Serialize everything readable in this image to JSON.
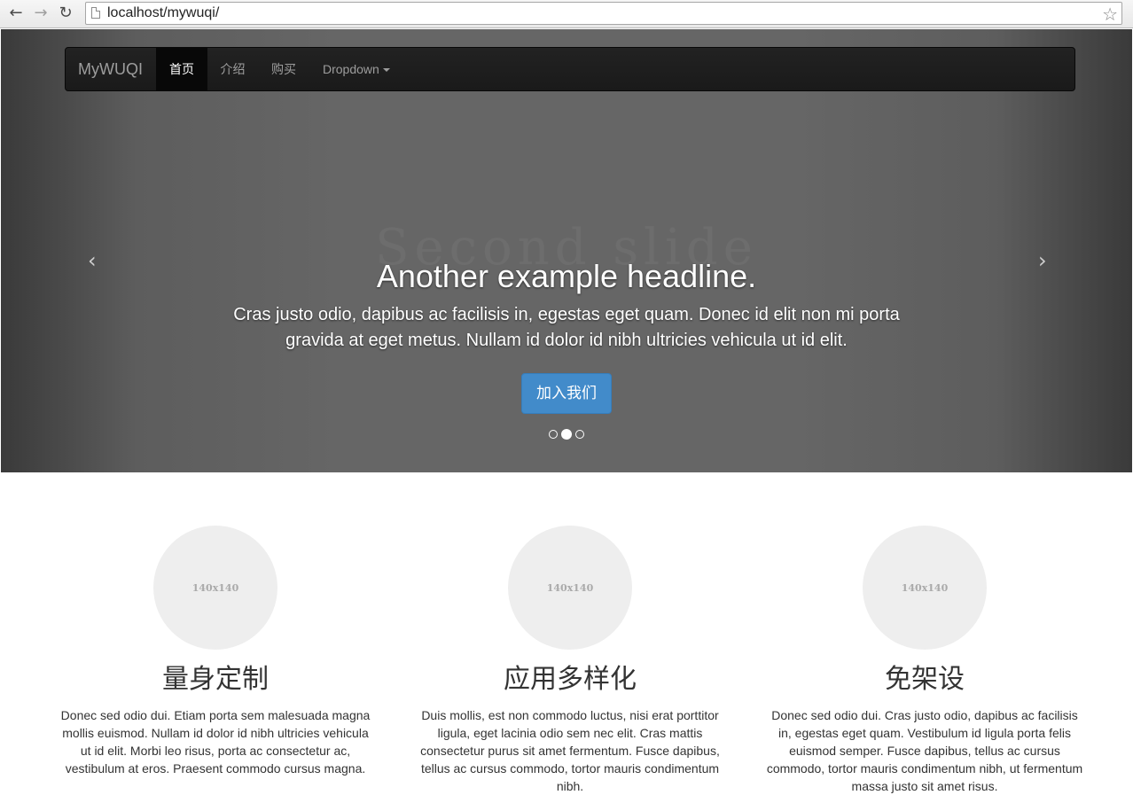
{
  "browser": {
    "back_glyph": "←",
    "forward_glyph": "→",
    "reload_glyph": "↻",
    "url": "localhost/mywuqi/",
    "star_glyph": "☆"
  },
  "navbar": {
    "brand": "MyWUQI",
    "items": [
      {
        "label": "首页",
        "active": true
      },
      {
        "label": "介绍"
      },
      {
        "label": "购买"
      },
      {
        "label": "Dropdown"
      }
    ]
  },
  "carousel": {
    "watermark": "Second slide",
    "headline": "Another example headline.",
    "lead": "Cras justo odio, dapibus ac facilisis in, egestas eget quam. Donec id elit non mi porta gravida at eget metus. Nullam id dolor id nibh ultricies vehicula ut id elit.",
    "button": "加入我们",
    "prev_glyph": "‹",
    "next_glyph": "›",
    "indicators": 3,
    "active_index": 1
  },
  "features": [
    {
      "image_label": "140x140",
      "title": "量身定制",
      "text": "Donec sed odio dui. Etiam porta sem malesuada magna mollis euismod. Nullam id dolor id nibh ultricies vehicula ut id elit. Morbi leo risus, porta ac consectetur ac, vestibulum at eros. Praesent commodo cursus magna."
    },
    {
      "image_label": "140x140",
      "title": "应用多样化",
      "text": "Duis mollis, est non commodo luctus, nisi erat porttitor ligula, eget lacinia odio sem nec elit. Cras mattis consectetur purus sit amet fermentum. Fusce dapibus, tellus ac cursus commodo, tortor mauris condimentum nibh."
    },
    {
      "image_label": "140x140",
      "title": "免架设",
      "text": "Donec sed odio dui. Cras justo odio, dapibus ac facilisis in, egestas eget quam. Vestibulum id ligula porta felis euismod semper. Fusce dapibus, tellus ac cursus commodo, tortor mauris condimentum nibh, ut fermentum massa justo sit amet risus."
    }
  ],
  "colors": {
    "primary": "#428bca",
    "navbar": "#222222",
    "placeholder": "#eeeeee"
  }
}
